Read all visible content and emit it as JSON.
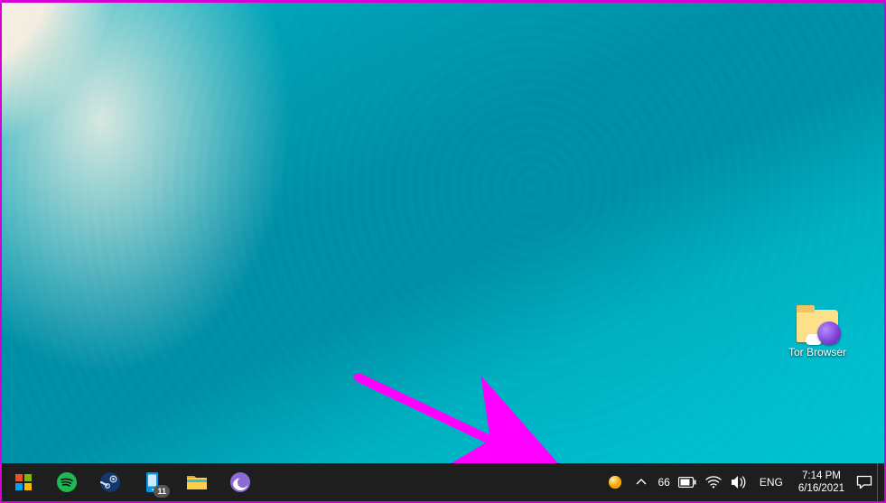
{
  "desktop": {
    "shortcut": {
      "label": "Tor Browser",
      "icon": "tor-folder-icon"
    }
  },
  "annotation": {
    "color": "#ff00ff",
    "target": "weather-tray-icon"
  },
  "taskbar": {
    "start": "Start",
    "apps": [
      {
        "name": "spotify",
        "icon": "spotify-icon"
      },
      {
        "name": "steam",
        "icon": "steam-icon"
      },
      {
        "name": "yourphone",
        "icon": "your-phone-icon",
        "badge": "11"
      },
      {
        "name": "explorer",
        "icon": "file-explorer-icon"
      },
      {
        "name": "firefox",
        "icon": "firefox-icon"
      }
    ],
    "tray": {
      "weather": {
        "temp": "66",
        "icon": "sun-icon"
      },
      "overflow": "^",
      "battery": "battery-icon",
      "wifi": "wifi-icon",
      "sound": "sound-icon",
      "ime": "ENG",
      "time": "7:14 PM",
      "date": "6/16/2021",
      "action_center": "action-center-icon"
    }
  }
}
